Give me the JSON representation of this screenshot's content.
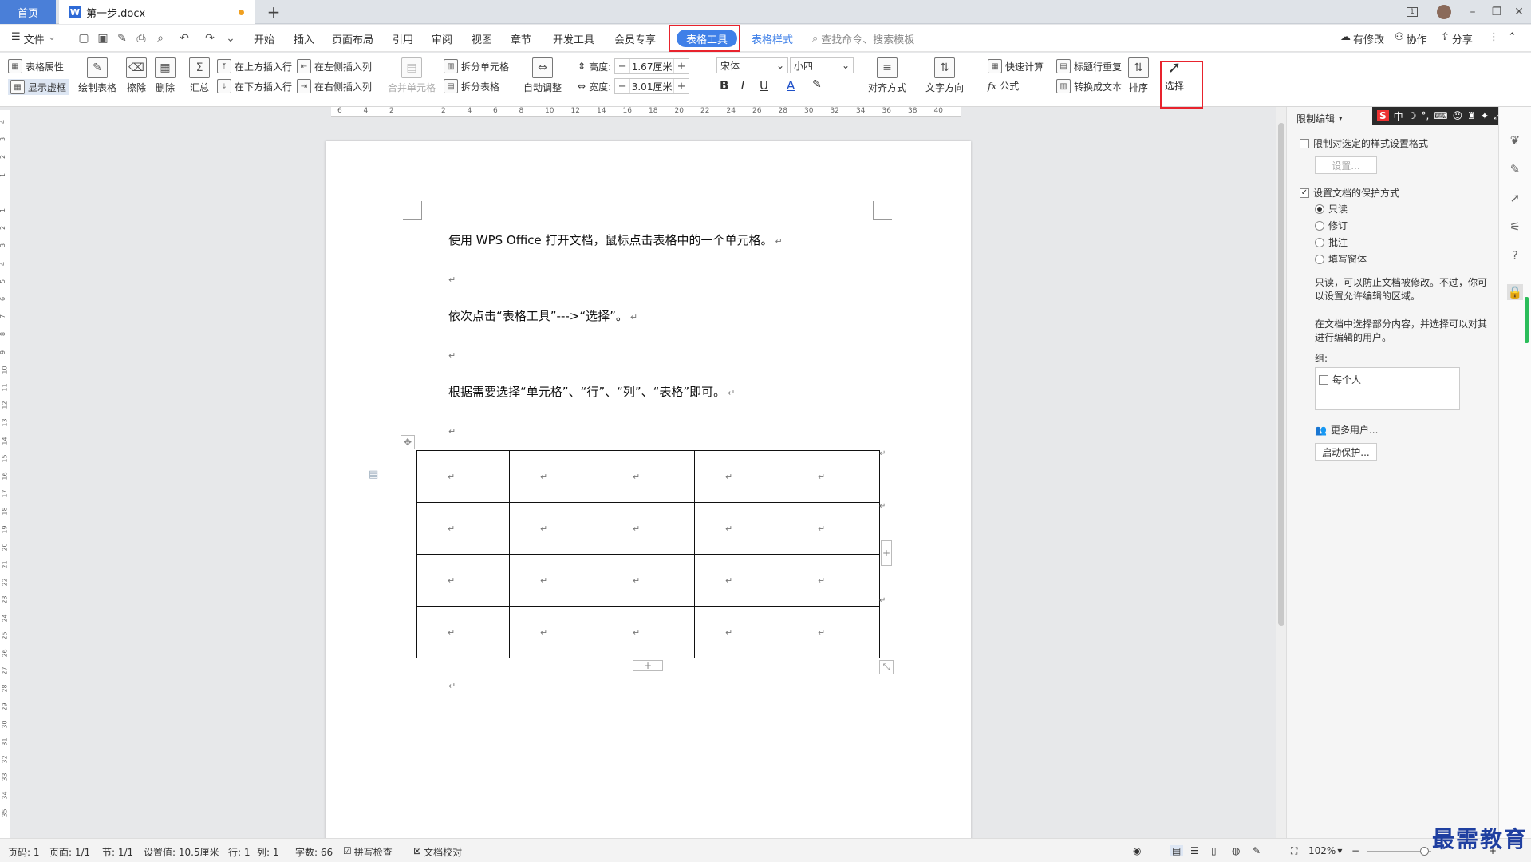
{
  "titlebar": {
    "home_tab": "首页",
    "doc_tab": "第一步.docx",
    "doc_icon": "W",
    "new_tab": "+",
    "badge": "1"
  },
  "menubar": {
    "file": "文件",
    "tabs": [
      "开始",
      "插入",
      "页面布局",
      "引用",
      "审阅",
      "视图",
      "章节",
      "开发工具",
      "会员专享"
    ],
    "active_tab": "表格工具",
    "table_style": "表格样式",
    "search": "查找命令、搜索模板",
    "modify": "有修改",
    "collab": "协作",
    "share": "分享"
  },
  "ribbon": {
    "table_props": "表格属性",
    "show_grid": "显示虚框",
    "draw_table": "绘制表格",
    "erase": "擦除",
    "delete": "删除",
    "summary": "汇总",
    "insert_above": "在上方插入行",
    "insert_below": "在下方插入行",
    "insert_left": "在左侧插入列",
    "insert_right": "在右侧插入列",
    "merge_cells": "合并单元格",
    "split_cells": "拆分单元格",
    "split_table": "拆分表格",
    "auto_fit": "自动调整",
    "height_label": "高度:",
    "height_value": "1.67厘米",
    "width_label": "宽度:",
    "width_value": "3.01厘米",
    "font_name": "宋体",
    "font_size": "小四",
    "align": "对齐方式",
    "text_dir": "文字方向",
    "quick_calc": "快速计算",
    "formula": "公式",
    "repeat_header": "标题行重复",
    "to_text": "转换成文本",
    "sort": "排序",
    "select": "选择"
  },
  "ruler": {
    "h_ticks": [
      "6",
      "4",
      "2",
      "",
      "2",
      "4",
      "6",
      "8",
      "10",
      "12",
      "14",
      "16",
      "18",
      "20",
      "22",
      "24",
      "26",
      "28",
      "30",
      "32",
      "34",
      "36",
      "38",
      "40"
    ],
    "v_ticks": [
      "4",
      "3",
      "2",
      "1",
      "",
      "1",
      "2",
      "3",
      "4",
      "5",
      "6",
      "7",
      "8",
      "9",
      "10",
      "11",
      "12",
      "13",
      "14",
      "15",
      "16",
      "17",
      "18",
      "19",
      "20",
      "21",
      "22",
      "23",
      "24",
      "25",
      "26",
      "27",
      "28",
      "29",
      "30",
      "31",
      "32",
      "33",
      "34",
      "35"
    ]
  },
  "document": {
    "para1": "使用 WPS Office 打开文档，鼠标点击表格中的一个单元格。",
    "para2": "依次点击“表格工具”--->“选择”。",
    "para3": "根据需要选择“单元格”、“行”、“列”、“表格”即可。",
    "return_mark": "↵",
    "add_row": "+",
    "add_col": "+"
  },
  "side_panel": {
    "title": "限制编辑",
    "restrict_format": "限制对选定的样式设置格式",
    "settings_btn": "设置...",
    "set_protect": "设置文档的保护方式",
    "options": [
      "只读",
      "修订",
      "批注",
      "填写窗体"
    ],
    "desc1": "只读，可以防止文档被修改。不过，你可以设置允许编辑的区域。",
    "desc2": "在文档中选择部分内容，并选择可以对其进行编辑的用户。",
    "group_label": "组:",
    "everyone": "每个人",
    "more_users": "更多用户...",
    "start_protect": "启动保护..."
  },
  "ime": {
    "logo": "S",
    "mode": "中"
  },
  "statusbar": {
    "page_code": "页码: 1",
    "page": "页面: 1/1",
    "section": "节: 1/1",
    "setting": "设置值: 10.5厘米",
    "row": "行: 1",
    "col": "列: 1",
    "words": "字数: 66",
    "spell": "拼写检查",
    "proof": "文档校对",
    "zoom": "102%"
  },
  "watermark": "最需教育",
  "colors": {
    "accent": "#3f80e8",
    "highlight": "#e8232d",
    "home_tab": "#4a7fd8"
  }
}
